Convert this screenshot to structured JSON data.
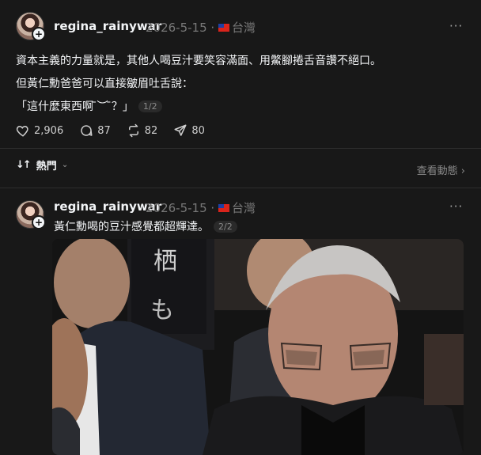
{
  "posts": [
    {
      "username": "regina_rainywar",
      "date": "2026-5-15",
      "location": "台灣",
      "more": "···",
      "lines": [
        "資本主義的力量就是，其他人喝豆汁要笑容滿面、用鱉腳捲舌音讚不絕口。",
        "但黃仁勳爸爸可以直接皺眉吐舌說：",
        "「這什麼東西啊 ̄︶ ̄？」"
      ],
      "page": "1/2",
      "likes": "2,906",
      "replies": "87",
      "reposts": "82",
      "shares": "80"
    },
    {
      "username": "regina_rainywar",
      "date": "2026-5-15",
      "location": "台灣",
      "more": "···",
      "lines": [
        "黃仁勳喝的豆汁感覺都超輝達。"
      ],
      "page": "2/2"
    }
  ],
  "sort": {
    "icon": "↓↑",
    "label": "熱門",
    "chevron": "⌄"
  },
  "view_activity": "查看動態 ›",
  "colors": {
    "background": "#181818",
    "text": "#f3f5f7",
    "muted": "#777777",
    "divider": "#2e2e2e"
  },
  "icons": [
    "heart-icon",
    "comment-icon",
    "repost-icon",
    "share-icon",
    "plus-icon",
    "flag-icon"
  ]
}
